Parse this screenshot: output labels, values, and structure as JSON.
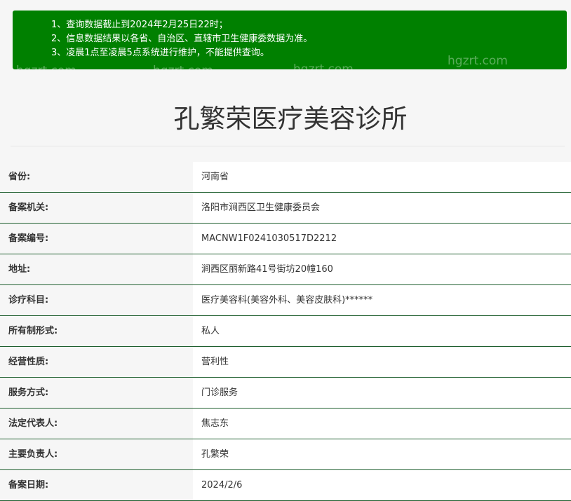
{
  "notice": {
    "lines": [
      "1、查询数据截止到2024年2月25日22时；",
      "2、信息数据结果以各省、自治区、直辖市卫生健康委数据为准。",
      "3、凌晨1点至凌晨5点系统进行维护，不能提供查询。"
    ],
    "watermarks": [
      "hgzrt.com",
      "hgzrt.com",
      "hgzrt.com",
      "hgzrt.com"
    ],
    "background_color": "#008000"
  },
  "page_title": "孔繁荣医疗美容诊所",
  "rows": [
    {
      "label": "省份:",
      "value": "河南省"
    },
    {
      "label": "备案机关:",
      "value": "洛阳市涧西区卫生健康委员会"
    },
    {
      "label": "备案编号:",
      "value": "MACNW1F0241030517D2212"
    },
    {
      "label": "地址:",
      "value": "涧西区丽新路41号街坊20幢160"
    },
    {
      "label": "诊疗科目:",
      "value": "医疗美容科(美容外科、美容皮肤科)******"
    },
    {
      "label": "所有制形式:",
      "value": "私人"
    },
    {
      "label": "经营性质:",
      "value": "营利性"
    },
    {
      "label": "服务方式:",
      "value": "门诊服务"
    },
    {
      "label": "法定代表人:",
      "value": "焦志东"
    },
    {
      "label": "主要负责人:",
      "value": "孔繁荣"
    },
    {
      "label": "备案日期:",
      "value": "2024/2/6"
    }
  ],
  "colors": {
    "row_divider": "#1f5f2f",
    "label_background": "#f6f6f6",
    "value_background": "#ffffff"
  }
}
